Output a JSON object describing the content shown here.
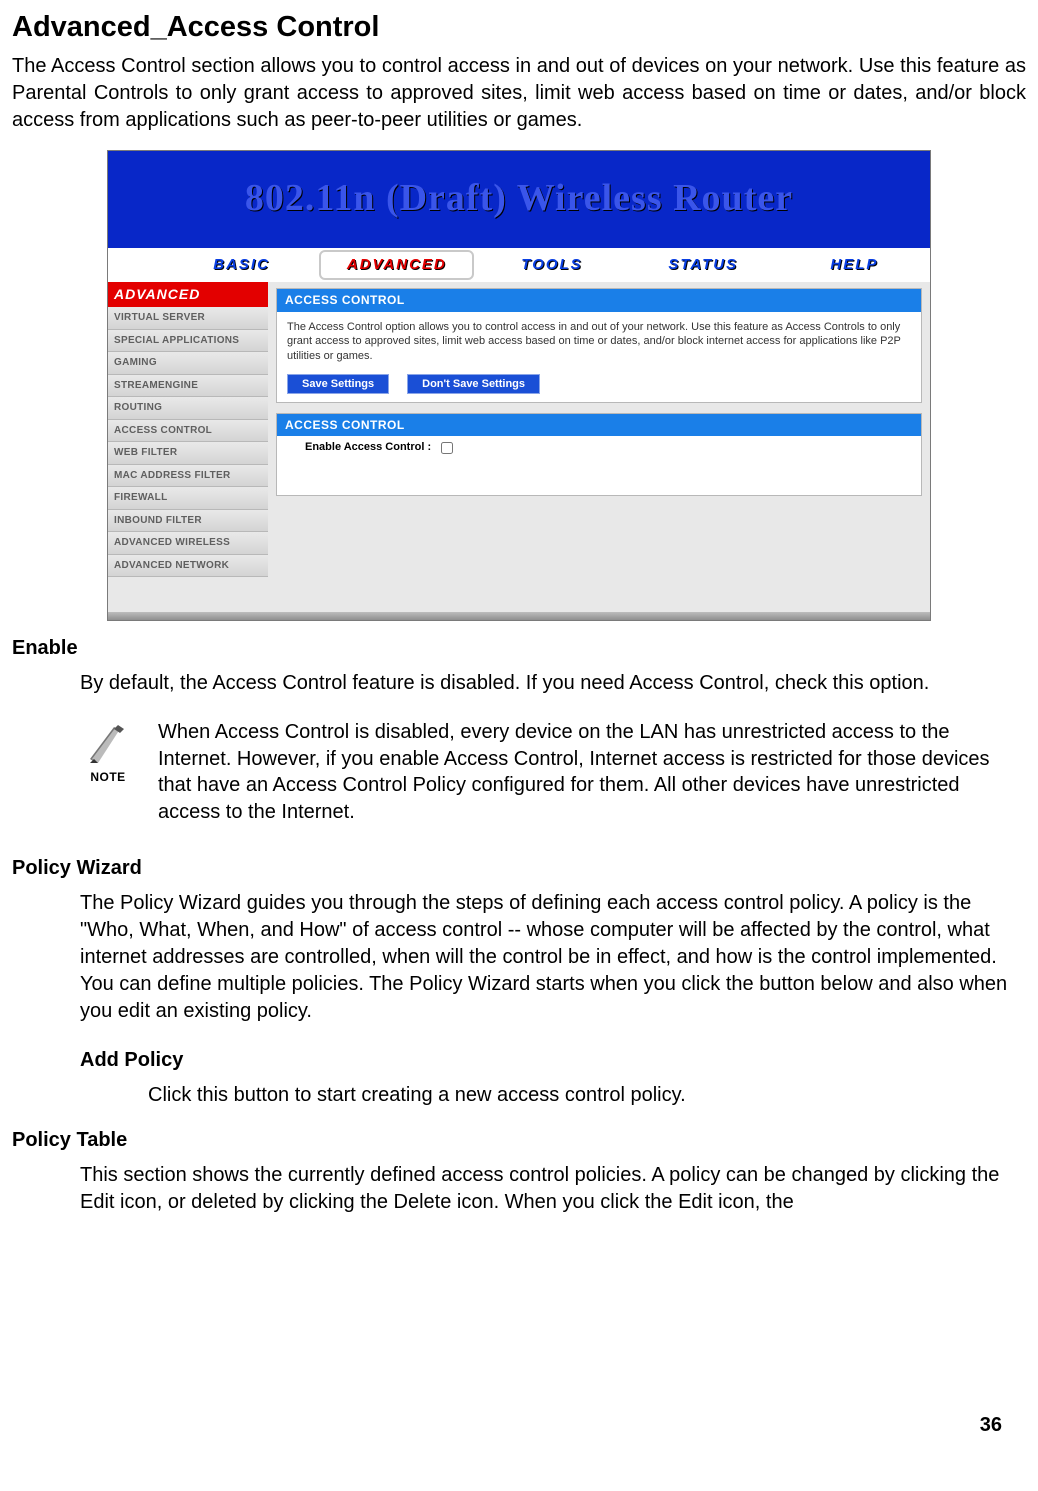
{
  "page": {
    "title": "Advanced_Access Control",
    "intro": "The Access Control section allows you to control access in and out of devices on your network. Use this feature as Parental Controls to only grant access to approved sites, limit web access based on time or dates, and/or block access from applications such as peer-to-peer utilities or games.",
    "number": "36"
  },
  "screenshot": {
    "banner": "802.11n (Draft) Wireless Router",
    "tabs": [
      "BASIC",
      "ADVANCED",
      "TOOLS",
      "STATUS",
      "HELP"
    ],
    "sidebar_head": "ADVANCED",
    "sidebar": [
      "VIRTUAL SERVER",
      "SPECIAL APPLICATIONS",
      "GAMING",
      "STREAMENGINE",
      "ROUTING",
      "ACCESS CONTROL",
      "WEB FILTER",
      "MAC ADDRESS FILTER",
      "FIREWALL",
      "INBOUND FILTER",
      "ADVANCED WIRELESS",
      "ADVANCED NETWORK"
    ],
    "panel1_head": "ACCESS CONTROL",
    "panel1_text": "The Access Control option allows you to control access in and out of your network. Use this feature as Access Controls to only grant access to approved sites, limit web access based on time or dates, and/or block internet access for applications like P2P utilities or games.",
    "save_btn": "Save Settings",
    "dont_save_btn": "Don't Save Settings",
    "panel2_head": "ACCESS CONTROL",
    "enable_label": "Enable Access Control :"
  },
  "sections": {
    "enable_label": "Enable",
    "enable_body": "By default, the Access Control feature is disabled. If you need Access Control, check this option.",
    "note_caption": "NOTE",
    "note_text": "When Access Control is disabled, every device on the LAN has unrestricted access to the Internet. However, if you enable Access Control, Internet access is restricted for those devices that have an Access Control Policy configured for them. All other devices have unrestricted access to the Internet.",
    "policy_wizard_label": "Policy Wizard",
    "policy_wizard_body": "The Policy Wizard guides you through the steps of defining each access control policy. A policy is the \"Who, What, When, and How\" of access control -- whose computer will be affected by the control, what internet addresses are controlled, when will the control be in effect, and how is the control implemented. You can define multiple policies. The Policy Wizard starts when you click the button below and also when you edit an existing policy.",
    "add_policy_label": "Add Policy",
    "add_policy_body": "Click this button to start creating a new access control policy.",
    "policy_table_label": "Policy Table",
    "policy_table_body": "This section shows the currently defined access control policies. A policy can be changed by clicking the Edit icon, or deleted by clicking the Delete icon. When you click the Edit icon, the"
  }
}
